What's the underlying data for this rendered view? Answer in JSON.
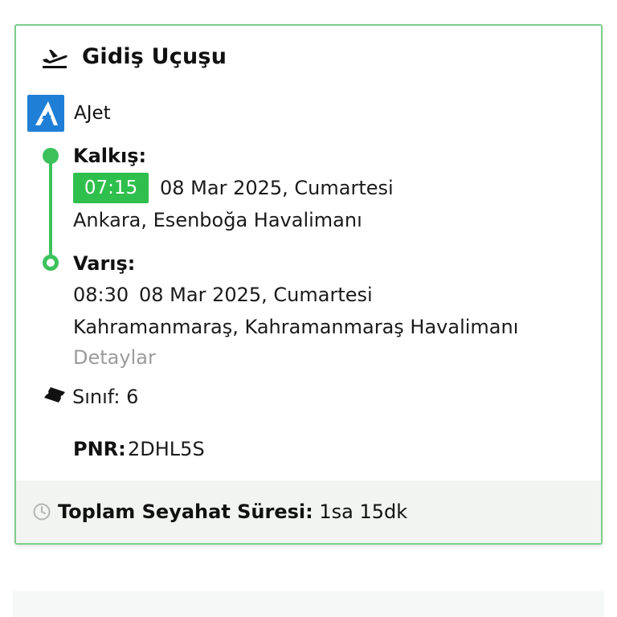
{
  "section": {
    "title": "Gidiş Uçuşu",
    "header_icon": "plane-departure-icon"
  },
  "airline": {
    "name": "AJet",
    "logo_color": "#1f7fd6"
  },
  "departure": {
    "label": "Kalkış:",
    "time": "07:15",
    "date": "08 Mar 2025, Cumartesi",
    "airport": "Ankara, Esenboğa Havalimanı"
  },
  "arrival": {
    "label": "Varış:",
    "time": "08:30",
    "date": "08 Mar 2025, Cumartesi",
    "airport": "Kahramanmaraş, Kahramanmaraş Havalimanı"
  },
  "details_link": "Detaylar",
  "class_info": {
    "text": "Sınıf: 6",
    "icon": "ticket-icon"
  },
  "pnr": {
    "label": "PNR:",
    "value": "2DHL5S"
  },
  "total_duration": {
    "label": "Toplam Seyahat Süresi:",
    "value": "1sa 15dk",
    "icon": "clock-icon"
  },
  "colors": {
    "accent_green": "#3cc15b",
    "card_border": "#7bcf8a",
    "muted_text": "#9b9b9b",
    "footer_bg": "#f2f4f2"
  }
}
